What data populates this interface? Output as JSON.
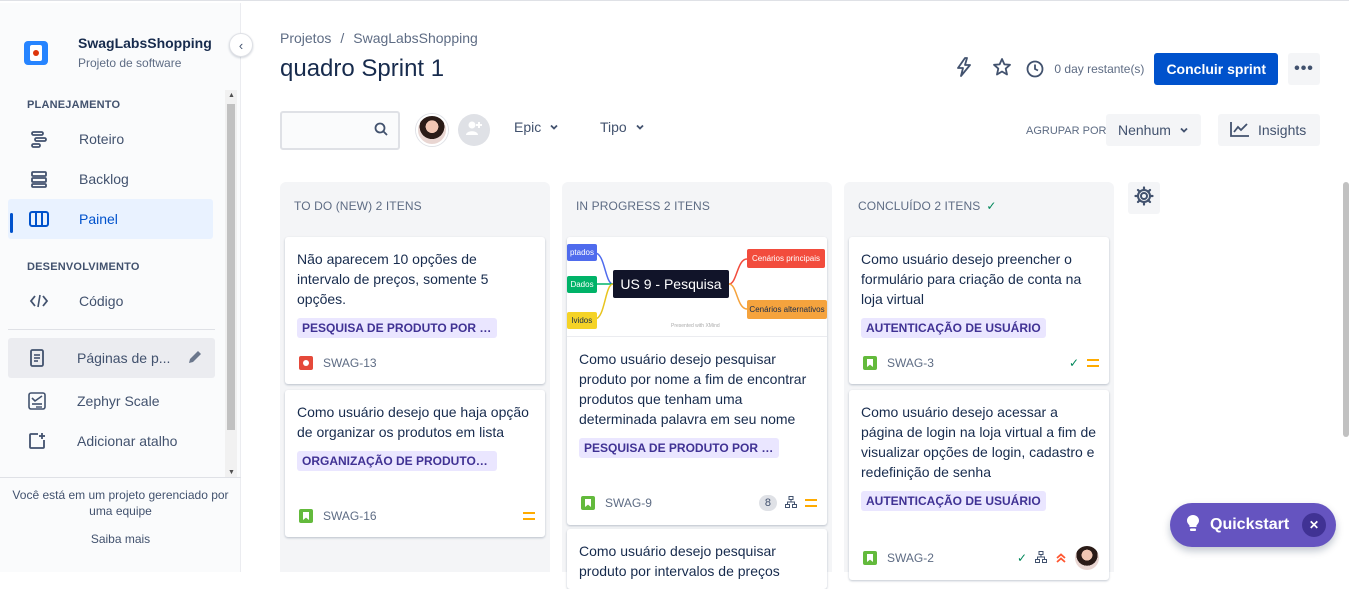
{
  "sidebar": {
    "project_name": "SwagLabsShopping",
    "project_type": "Projeto de software",
    "section_planning": "PLANEJAMENTO",
    "section_dev": "DESENVOLVIMENTO",
    "items": [
      {
        "label": "Roteiro"
      },
      {
        "label": "Backlog"
      },
      {
        "label": "Painel"
      },
      {
        "label": "Código"
      },
      {
        "label": "Páginas de p..."
      },
      {
        "label": "Zephyr Scale"
      },
      {
        "label": "Adicionar atalho"
      }
    ],
    "footer_text": "Você está em um projeto gerenciado por uma equipe",
    "footer_link": "Saiba mais"
  },
  "header": {
    "breadcrumb_root": "Projetos",
    "breadcrumb_sep": "/",
    "breadcrumb_project": "SwagLabsShopping",
    "title": "quadro Sprint 1",
    "days_remaining": "0 day restante(s)",
    "complete_button": "Concluir sprint",
    "more_label": "•••"
  },
  "filters": {
    "epic_label": "Epic",
    "type_label": "Tipo",
    "group_by_label": "AGRUPAR POR",
    "group_by_value": "Nenhum",
    "insights_label": "Insights"
  },
  "columns": [
    {
      "title": "TO DO (NEW) 2 ITENS",
      "cards": [
        {
          "summary": "Não aparecem 10 opções de intervalo de preços, somente 5 opções.",
          "epic": "PESQUISA DE PRODUTO POR INTE...",
          "key": "SWAG-13",
          "type": "bug"
        },
        {
          "summary": "Como usuário desejo que haja opção de organizar os produtos em lista",
          "epic": "ORGANIZAÇÃO DE PRODUTOS EM ...",
          "key": "SWAG-16",
          "type": "story",
          "priority": "medium"
        }
      ]
    },
    {
      "title": "IN PROGRESS 2 ITENS",
      "cards": [
        {
          "summary": "Como usuário desejo pesquisar produto por nome a fim de encontrar produtos que tenham uma determinada palavra em seu nome",
          "epic": "PESQUISA DE PRODUTO POR NOME",
          "key": "SWAG-9",
          "type": "story",
          "subtasks": "8",
          "priority": "medium",
          "cover": {
            "center": "US 9 - Pesquisa",
            "left_nodes": [
              "ptados",
              "Dados",
              "lvidos"
            ],
            "right_nodes": [
              "Cenários principais",
              "Cenários alternativos"
            ],
            "credit": "Presented with XMind",
            "colors": {
              "blue": "#4f6bed",
              "green": "#00b368",
              "yellow": "#f5d327",
              "red": "#f24c3d",
              "orange": "#f5a33d"
            }
          }
        },
        {
          "summary": "Como usuário desejo pesquisar produto por intervalos de preços"
        }
      ]
    },
    {
      "title": "CONCLUÍDO 2 ITENS",
      "cards": [
        {
          "summary": "Como usuário desejo preencher o formulário para criação de conta na loja virtual",
          "epic": "AUTENTICAÇÃO DE USUÁRIO",
          "key": "SWAG-3",
          "type": "story",
          "priority": "medium"
        },
        {
          "summary": "Como usuário desejo acessar a página de login na loja virtual a fim de visualizar opções de login, cadastro e redefinição de senha",
          "epic": "AUTENTICAÇÃO DE USUÁRIO",
          "key": "SWAG-2",
          "type": "story",
          "priority": "high"
        }
      ]
    }
  ],
  "quickstart": {
    "label": "Quickstart",
    "close": "✕"
  },
  "colors": {
    "primary": "#0052cc",
    "epic_bg": "#eae6ff",
    "epic_text": "#403294",
    "quickstart": "#6554c0",
    "done": "#00875a"
  }
}
